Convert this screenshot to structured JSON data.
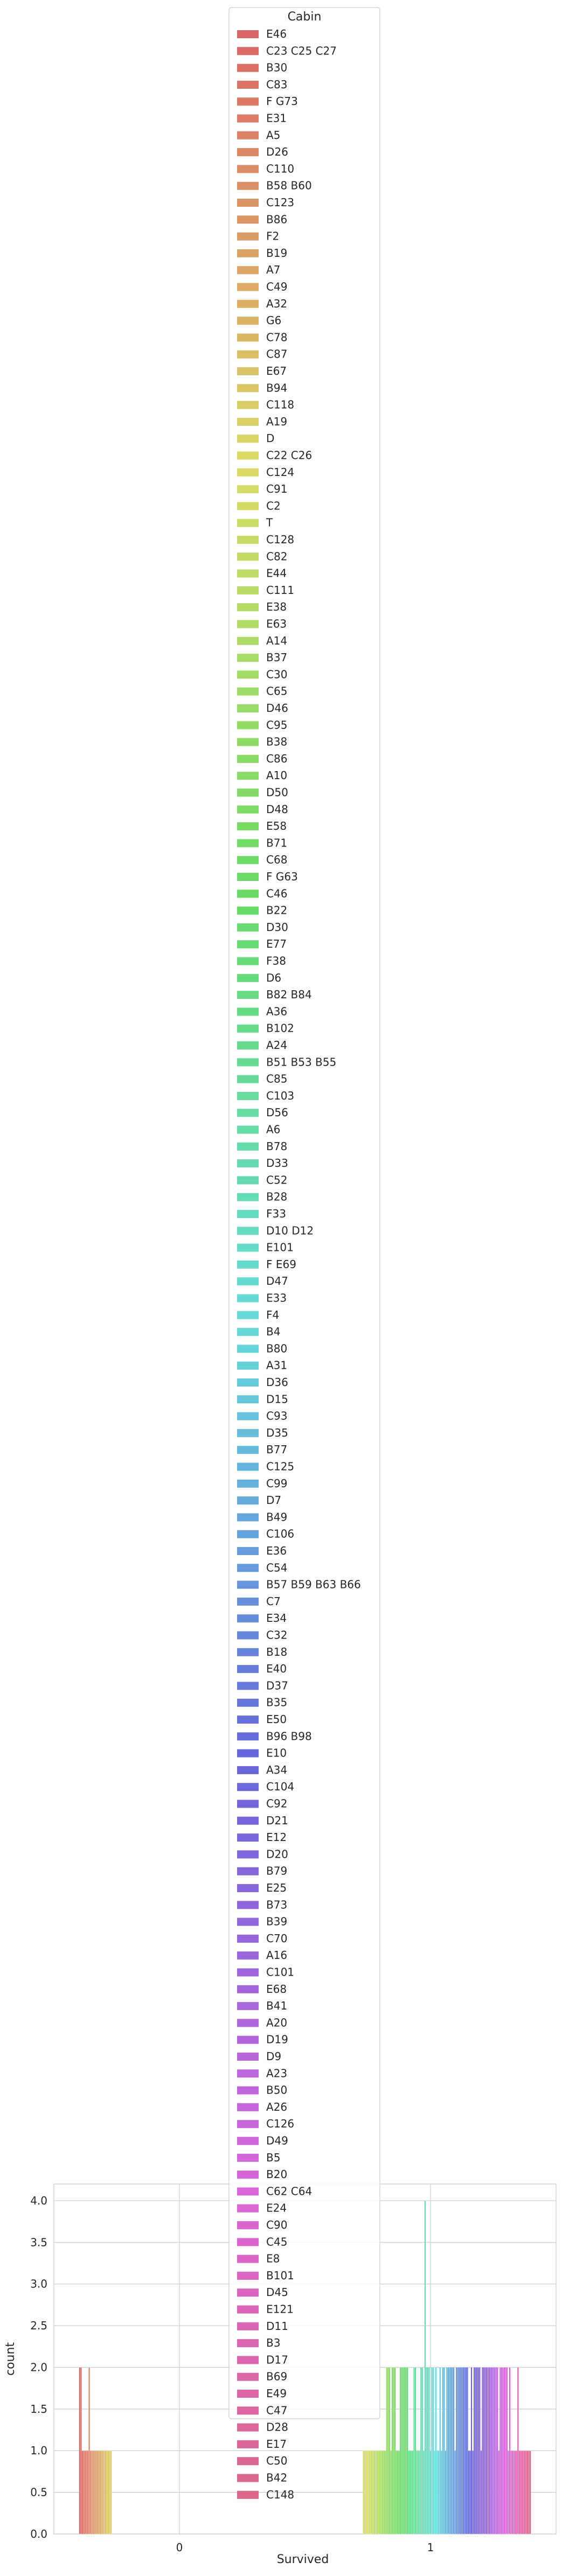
{
  "chart_data": {
    "type": "bar",
    "title": "",
    "xlabel": "Survived",
    "ylabel": "count",
    "categories": [
      "0",
      "1"
    ],
    "ylim": [
      0,
      4.2
    ],
    "yticks": [
      "0.0",
      "0.5",
      "1.0",
      "1.5",
      "2.0",
      "2.5",
      "3.0",
      "3.5",
      "4.0"
    ],
    "grid": true,
    "legend": {
      "title": "Cabin",
      "placement": "upper center",
      "entries": [
        "E46",
        "C23 C25 C27",
        "B30",
        "C83",
        "F G73",
        "E31",
        "A5",
        "D26",
        "C110",
        "B58 B60",
        "C123",
        "B86",
        "F2",
        "B19",
        "A7",
        "C49",
        "A32",
        "G6",
        "C78",
        "C87",
        "E67",
        "B94",
        "C118",
        "A19",
        "D",
        "C22 C26",
        "C124",
        "C91",
        "C2",
        "T",
        "C128",
        "C82",
        "E44",
        "C111",
        "E38",
        "E63",
        "A14",
        "B37",
        "C30",
        "C65",
        "D46",
        "C95",
        "B38",
        "C86",
        "A10",
        "D50",
        "D48",
        "E58",
        "B71",
        "C68",
        "F G63",
        "C46",
        "B22",
        "D30",
        "E77",
        "F38",
        "D6",
        "B82 B84",
        "A36",
        "B102",
        "A24",
        "B51 B53 B55",
        "C85",
        "C103",
        "D56",
        "A6",
        "B78",
        "D33",
        "C52",
        "B28",
        "F33",
        "D10 D12",
        "E101",
        "F E69",
        "D47",
        "E33",
        "F4",
        "B4",
        "B80",
        "A31",
        "D36",
        "D15",
        "C93",
        "D35",
        "B77",
        "C125",
        "C99",
        "D7",
        "B49",
        "C106",
        "E36",
        "C54",
        "B57 B59 B63 B66",
        "C7",
        "E34",
        "C32",
        "B18",
        "E40",
        "D37",
        "B35",
        "E50",
        "B96 B98",
        "E10",
        "A34",
        "C104",
        "C92",
        "D21",
        "E12",
        "D20",
        "B79",
        "E25",
        "B73",
        "B39",
        "C70",
        "A16",
        "C101",
        "E68",
        "B41",
        "A20",
        "D19",
        "D9",
        "A23",
        "B50",
        "A26",
        "C126",
        "D49",
        "B5",
        "B20",
        "C62 C64",
        "E24",
        "C90",
        "C45",
        "E8",
        "B101",
        "D45",
        "E121",
        "D11",
        "B3",
        "D17",
        "B69",
        "E49",
        "C47",
        "D28",
        "E17",
        "C50",
        "B42",
        "C148"
      ]
    },
    "series_values": {
      "0": [
        2,
        2,
        1,
        1,
        1,
        1,
        1,
        2,
        1,
        1,
        1,
        1,
        1,
        1,
        1,
        1,
        1,
        1,
        1,
        1,
        1,
        1,
        1,
        1,
        0,
        0,
        0,
        0,
        0,
        0,
        0,
        0,
        0,
        0,
        0,
        0,
        0,
        0,
        0,
        0,
        0,
        0,
        0,
        0,
        0,
        0,
        0,
        0,
        0,
        0,
        0,
        0,
        0,
        0,
        0,
        0,
        0,
        0,
        0,
        0,
        0,
        0,
        0,
        0,
        0,
        0,
        0,
        0,
        0,
        0,
        0,
        0,
        0,
        0,
        0,
        0,
        0,
        0,
        0,
        0,
        0,
        0,
        0,
        0,
        0,
        0,
        0,
        0,
        0,
        0,
        0,
        0,
        0,
        0,
        0,
        0,
        0,
        0,
        0,
        0,
        0,
        0,
        0,
        0,
        0,
        0,
        0,
        0,
        0,
        0,
        0,
        0,
        0,
        0,
        0,
        0,
        0,
        0,
        0,
        0,
        0,
        0,
        0,
        0,
        0,
        0,
        0,
        0,
        0,
        0,
        0,
        0,
        0,
        0,
        0,
        0,
        0,
        0,
        0,
        0,
        0,
        0,
        0,
        0,
        0,
        0,
        0
      ],
      "1": [
        0,
        0,
        0,
        0,
        0,
        0,
        0,
        0,
        0,
        0,
        0,
        0,
        0,
        0,
        0,
        0,
        0,
        0,
        0,
        0,
        0,
        0,
        0,
        0,
        1,
        1,
        1,
        1,
        1,
        1,
        1,
        1,
        1,
        1,
        1,
        1,
        1,
        1,
        1,
        1,
        1,
        2,
        2,
        2,
        1,
        2,
        2,
        2,
        1,
        1,
        1,
        2,
        2,
        2,
        2,
        2,
        2,
        1,
        1,
        1,
        1,
        2,
        2,
        1,
        1,
        1,
        2,
        2,
        1,
        4,
        2,
        2,
        2,
        1,
        2,
        2,
        1,
        2,
        1,
        1,
        2,
        1,
        2,
        2,
        1,
        2,
        2,
        2,
        2,
        2,
        2,
        1,
        2,
        2,
        2,
        2,
        2,
        2,
        2,
        2,
        2,
        1,
        1,
        2,
        1,
        2,
        2,
        2,
        2,
        2,
        1,
        2,
        2,
        2,
        2,
        2,
        2,
        2,
        2,
        2,
        2,
        2,
        2,
        1,
        2,
        2,
        2,
        2,
        2,
        2,
        1,
        2,
        1,
        1,
        1,
        1,
        1,
        2,
        1,
        1,
        1,
        1,
        1,
        1,
        1,
        1,
        1
      ]
    }
  }
}
